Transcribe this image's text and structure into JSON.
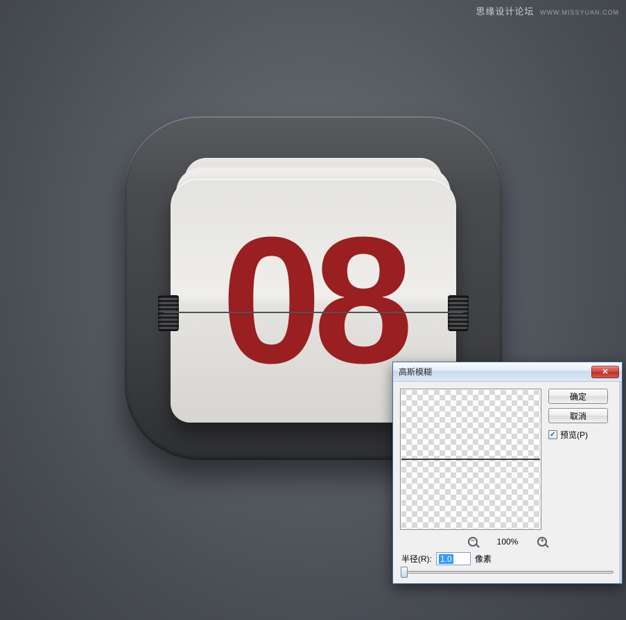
{
  "watermark": {
    "title": "思缘设计论坛",
    "url": "WWW.MISSYUAN.COM"
  },
  "icon": {
    "number": "08"
  },
  "dialog": {
    "title": "高斯模糊",
    "ok": "确定",
    "cancel": "取消",
    "preview_label": "预览(P)",
    "preview_checked": true,
    "zoom": "100%",
    "radius_label": "半径(R):",
    "radius_value": "1.0",
    "radius_unit": "像素"
  }
}
